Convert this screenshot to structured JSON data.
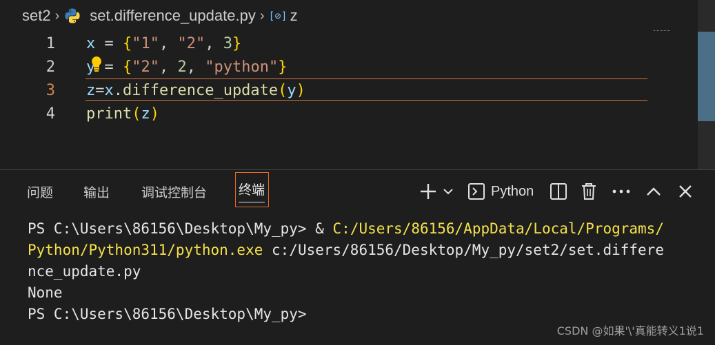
{
  "breadcrumb": {
    "folder": "set2",
    "file": "set.difference_update.py",
    "symbol": "z",
    "symbol_icon": "symbol-variable-icon",
    "file_icon": "python-icon"
  },
  "editor": {
    "lines": [
      {
        "number": "1"
      },
      {
        "number": "2"
      },
      {
        "number": "3"
      },
      {
        "number": "4"
      }
    ],
    "line1": {
      "var": "x",
      "eq": " = ",
      "open": "{",
      "s1": "\"1\"",
      "c1": ", ",
      "s2": "\"2\"",
      "c2": ", ",
      "n1": "3",
      "close": "}"
    },
    "line2": {
      "var": "y",
      "eq": " = ",
      "open": "{",
      "s1": "\"2\"",
      "c1": ", ",
      "n1": "2",
      "c2": ", ",
      "s2": "\"python\"",
      "close": "}"
    },
    "line3": {
      "target": "z",
      "eq": "=",
      "obj": "x",
      "dot": ".",
      "method": "difference_update",
      "open": "(",
      "arg": "y",
      "close": ")"
    },
    "line4": {
      "fn": "print",
      "open": "(",
      "arg": "z",
      "close": ")"
    }
  },
  "panel": {
    "tabs": [
      "问题",
      "输出",
      "调试控制台",
      "终端"
    ],
    "active_tab": "终端",
    "terminal_name": "Python",
    "icons": [
      "plus-icon",
      "chevron-down-icon",
      "terminal-icon",
      "split-icon",
      "trash-icon",
      "more-icon",
      "chevron-up-icon",
      "close-icon"
    ]
  },
  "terminal": {
    "l1_prompt": "PS C:\\Users\\86156\\Desktop\\My_py> ",
    "l1_amp": "& ",
    "l1_path": "C:/Users/86156/AppData/Local/Programs/",
    "l2_path": "Python/Python311/python.exe",
    "l2_rest": " c:/Users/86156/Desktop/My_py/set2/set.differe",
    "l3": "nce_update.py",
    "l4": "None",
    "l5": "PS C:\\Users\\86156\\Desktop\\My_py>"
  },
  "watermark": "CSDN @如果'\\'真能转义1说1",
  "colors": {
    "accent": "#e2692b",
    "string": "#ce9178",
    "variable": "#9cdcfe",
    "function": "#dcdcaa",
    "path_yellow": "#f5e14a"
  }
}
